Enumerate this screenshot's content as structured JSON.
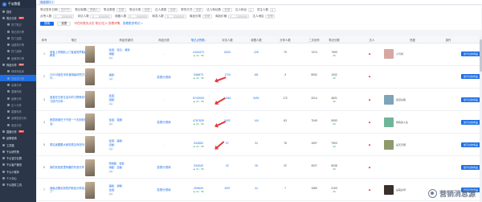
{
  "sidebar": {
    "brand": "千瓜数据",
    "items": [
      {
        "label": "首页",
        "cls": "group"
      },
      {
        "label": "笔记分析",
        "cls": "group",
        "hot": "NEW"
      },
      {
        "label": "热门笔记",
        "cls": "sub"
      },
      {
        "label": "笔记排行榜",
        "cls": "sub"
      },
      {
        "label": "热门话题",
        "cls": "sub"
      },
      {
        "label": "话题排行榜",
        "cls": "sub"
      },
      {
        "label": "热门品牌",
        "cls": "sub"
      },
      {
        "label": "品牌排行榜",
        "cls": "sub"
      },
      {
        "label": "商品分析",
        "cls": "group",
        "hot": "NEW"
      },
      {
        "label": "种草商品库",
        "cls": "sub"
      },
      {
        "label": "商品排行榜",
        "cls": "sub active"
      },
      {
        "label": "店铺分析",
        "cls": "sub"
      },
      {
        "label": "直播商品",
        "cls": "sub"
      },
      {
        "label": "品牌分析",
        "cls": "sub"
      },
      {
        "label": "达人分析",
        "cls": "sub"
      },
      {
        "label": "直播电商",
        "cls": "sub"
      },
      {
        "label": "品牌投放分析",
        "cls": "sub"
      },
      {
        "label": "竞品分析",
        "cls": "sub"
      },
      {
        "label": "直播分析",
        "cls": "group",
        "hot": "NEW"
      },
      {
        "label": "品牌营销",
        "cls": "group"
      },
      {
        "label": "工具箱",
        "cls": "group"
      },
      {
        "label": "千瓜研究院",
        "cls": "group"
      },
      {
        "label": "千瓜官方社群",
        "cls": "group"
      },
      {
        "label": "千瓜客户服务",
        "cls": "group"
      },
      {
        "label": "千瓜小程序",
        "cls": "group"
      },
      {
        "label": "个人中心",
        "cls": "group"
      },
      {
        "label": "千瓜插件工具",
        "cls": "group"
      }
    ]
  },
  "topbar": {
    "tab": "商品排行 ×"
  },
  "filters": {
    "row1": [
      {
        "label": "笔记发布日期",
        "value": "近30天"
      },
      {
        "label": "笔记标题",
        "value": "请输入"
      },
      {
        "label": "笔记类型",
        "value": "全部"
      },
      {
        "label": "笔记分类",
        "value": "全部"
      },
      {
        "label": "达人类型",
        "value": "全部"
      },
      {
        "label": "带货方式",
        "value": "全部"
      },
      {
        "label": "达人粉丝数",
        "value": "全部"
      },
      {
        "label": "达人粉丝",
        "value": "0"
      },
      {
        "label": "关注人数",
        "value": "0"
      }
    ],
    "row2": [
      {
        "label": "点赞人数",
        "value": "0 — 1000000"
      },
      {
        "label": "评论人数",
        "value": "0 — 1000000"
      },
      {
        "label": "收藏人数",
        "value": "0 — 1000000"
      },
      {
        "label": "转发人数",
        "value": "0 — 1000000"
      },
      {
        "label": "商品分类",
        "value": "全部"
      },
      {
        "label": "商品价格",
        "value": "0 — 1000000"
      },
      {
        "label": "达人地区",
        "value": "全部"
      }
    ],
    "search_label": "搜索",
    "reset_label": "重置",
    "hint": "可在列表页点击 笔记/达人 查看详情，",
    "hint_link": "查看更多笔记 >"
  },
  "table": {
    "headers": [
      "序号",
      "笔记",
      "商品关键词",
      "商品分类",
      "笔记点赞数↓",
      "评论人数",
      "收藏人数",
      "分享人数",
      "二次创作",
      "笔记分数",
      "达人",
      "热度",
      "操作"
    ],
    "rows": [
      {
        "idx": "1",
        "title": "宝宝上学期前入门宝宝的早期启蒙教育...",
        "tags": [
          [
            "生活",
            "育儿",
            "教育"
          ],
          [
            "母婴"
          ]
        ],
        "goods": "-",
        "likes": "2434472",
        "up": "▲ 21 ↑ 56",
        "comments": [
          "8493",
          "-"
        ],
        "favs": [
          "228",
          "-"
        ],
        "shares": [
          "79",
          "-"
        ],
        "second": [
          "7474",
          "-"
        ],
        "score": [
          "7390",
          "40"
        ],
        "red": "◆",
        "author": "小与妈",
        "av": "#d8a7a1",
        "op": "加平台的商品"
      },
      {
        "idx": "2",
        "title": "OOOO姐在手机使用最好的方法技巧...",
        "tags": [
          [
            "美食"
          ]
        ],
        "goods": "混搭/分类库",
        "likes": "348873",
        "up": "▲ 21 ↑ 56",
        "comments": [
          "1703",
          "-"
        ],
        "favs": [
          "181",
          "-"
        ],
        "shares": [
          "3",
          "-"
        ],
        "second": [
          "5932",
          "-"
        ],
        "score": [
          "1002",
          "40"
        ],
        "red": "◆",
        "author": "",
        "av": "#ffffff",
        "op": "加平台的商品"
      },
      {
        "idx": "3",
        "title": "宝宝在日常生活中的习惯养成与学习技巧分享...",
        "tags": [
          [
            "生活"
          ],
          [
            "家居"
          ]
        ],
        "goods": "-",
        "likes": "5743000",
        "up": "▲ 21 ↑ 56",
        "comments": [
          "14461",
          "-"
        ],
        "favs": [
          "5491",
          "-"
        ],
        "shares": [
          "172",
          "-"
        ],
        "second": [
          "3214",
          "-"
        ],
        "score": [
          "4621",
          "40"
        ],
        "red": "◆",
        "author": "霸道总裁",
        "av": "#7fa3b8",
        "op": "加平台的商品"
      },
      {
        "idx": "4",
        "title": "家居收纳在于不是一个去到你的生活...",
        "tags": [
          [
            "生活",
            "家居"
          ]
        ],
        "goods": "混搭/分类库",
        "likes": "4787839",
        "up": "▲ 21 ↑ 56",
        "comments": [
          "5492",
          "-"
        ],
        "favs": [
          "144",
          "-"
        ],
        "shares": [
          "63",
          "-"
        ],
        "second": [
          "7049",
          "-"
        ],
        "score": [
          "5093",
          "40"
        ],
        "red": "◆",
        "author": "绿色的人生",
        "av": "#6fb59a",
        "op": "加平台的商品"
      },
      {
        "idx": "5",
        "title": "再见我要跟大家说再见你在吗...",
        "tags": [
          [
            "生活",
            "美妆"
          ],
          [
            "日常"
          ]
        ],
        "goods": "-",
        "likes": "344552",
        "up": "▲ 21 ↑ 56",
        "comments": [
          "57",
          "-"
        ],
        "favs": [
          "34",
          "-"
        ],
        "shares": [
          "78",
          "-"
        ],
        "second": [
          "1097",
          "-"
        ],
        "score": [
          "7903",
          "40"
        ],
        "red": "◆",
        "author": "是天天啊",
        "av": "#8e9a6b",
        "op": "加平台的商品"
      },
      {
        "idx": "6",
        "title": "我的实验室里有趣的东西分享",
        "tags": [
          [
            "化妆品",
            "女生"
          ],
          [
            "母婴",
            "日常"
          ]
        ],
        "goods": "混搭/分类库",
        "likes": "334040",
        "up": "▲ 21 ↑ 56",
        "comments": [
          "32",
          "-"
        ],
        "favs": [
          "28",
          "-"
        ],
        "shares": [
          "22",
          "-"
        ],
        "second": [
          "3027",
          "-"
        ],
        "score": [
          "5038",
          "40"
        ],
        "red": "◆",
        "author": "",
        "av": "#ffffff",
        "op": "加平台的商品"
      },
      {
        "idx": "7",
        "title": "我最近刚买到的护肤品分享给大家了~",
        "tags": [
          [
            "美妆",
            "护肤"
          ],
          [
            "生活"
          ]
        ],
        "goods": "混搭/分类库",
        "likes": "209640",
        "up": "▲ 21 ↑ 56",
        "comments": [
          "3497",
          "-"
        ],
        "favs": [
          "44",
          "-"
        ],
        "shares": [
          "7",
          "-"
        ],
        "second": [
          "1089",
          "-"
        ],
        "score": [
          "2100",
          "40"
        ],
        "red": "◆",
        "author": "是美女呀",
        "av": "#3a2f2b",
        "op": "加平台的商品"
      }
    ]
  },
  "watermark": "营销消息源"
}
